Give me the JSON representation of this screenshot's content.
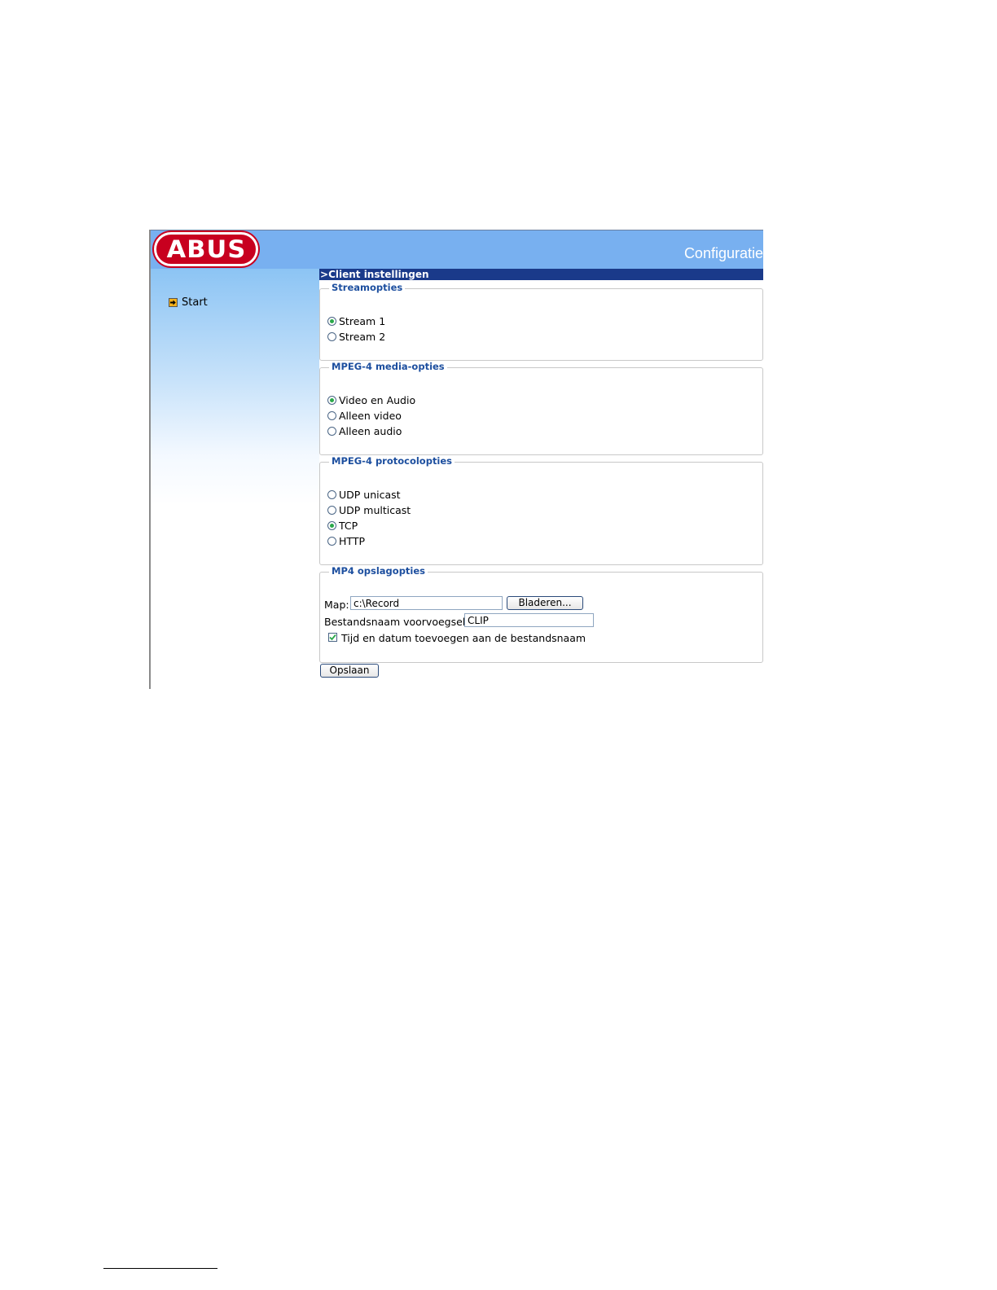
{
  "header": {
    "logo_text": "ABUS",
    "title": "Configuratie",
    "colors": {
      "header_bg": "#78b0f0",
      "logo_red": "#c8001f",
      "titlebar_bg": "#1a3a8a",
      "legend_blue": "#1d4f9f"
    }
  },
  "sidebar": {
    "items": [
      {
        "label": "Start",
        "icon": "arrow-right-icon"
      }
    ]
  },
  "page": {
    "title": "Client instellingen",
    "title_prefix": ">"
  },
  "stream_options": {
    "legend": "Streamopties",
    "options": [
      {
        "label": "Stream 1",
        "selected": true
      },
      {
        "label": "Stream 2",
        "selected": false
      }
    ]
  },
  "media_options": {
    "legend": "MPEG-4 media-opties",
    "options": [
      {
        "label": "Video en Audio",
        "selected": true
      },
      {
        "label": "Alleen video",
        "selected": false
      },
      {
        "label": "Alleen audio",
        "selected": false
      }
    ]
  },
  "protocol_options": {
    "legend": "MPEG-4 protocolopties",
    "options": [
      {
        "label": "UDP unicast",
        "selected": false
      },
      {
        "label": "UDP multicast",
        "selected": false
      },
      {
        "label": "TCP",
        "selected": true
      },
      {
        "label": "HTTP",
        "selected": false
      }
    ]
  },
  "storage_options": {
    "legend": "MP4 opslagopties",
    "folder_label": "Map:",
    "folder_value": "c:\\Record",
    "browse_label": "Bladeren...",
    "prefix_label": "Bestandsnaam voorvoegsel:",
    "prefix_value": "CLIP",
    "timestamp_label": "Tijd en datum toevoegen aan de bestandsnaam",
    "timestamp_checked": true
  },
  "save_label": "Opslaan"
}
